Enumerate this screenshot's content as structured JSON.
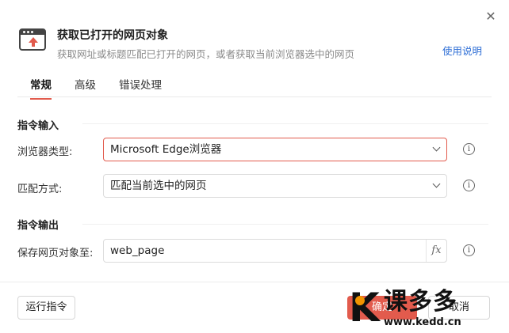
{
  "header": {
    "title": "获取已打开的网页对象",
    "subtitle": "获取网址或标题匹配已打开的网页，或者获取当前浏览器选中的网页",
    "help_link": "使用说明"
  },
  "tabs": [
    {
      "label": "常规",
      "active": true
    },
    {
      "label": "高级",
      "active": false
    },
    {
      "label": "错误处理",
      "active": false
    }
  ],
  "input_section": {
    "title": "指令输入",
    "fields": [
      {
        "label": "浏览器类型:",
        "value": "Microsoft Edge浏览器"
      },
      {
        "label": "匹配方式:",
        "value": "匹配当前选中的网页"
      }
    ]
  },
  "output_section": {
    "title": "指令输出",
    "fields": [
      {
        "label": "保存网页对象至:",
        "value": "web_page",
        "fx": "fx"
      }
    ]
  },
  "footer": {
    "run_label": "运行指令",
    "ok_label": "确定",
    "cancel_label": "取消"
  },
  "watermark": {
    "brand_letter": "K",
    "brand_text": "课多多",
    "url": "www.kedd.cn"
  },
  "colors": {
    "accent": "#e25b4d",
    "link": "#2f6fd6"
  }
}
